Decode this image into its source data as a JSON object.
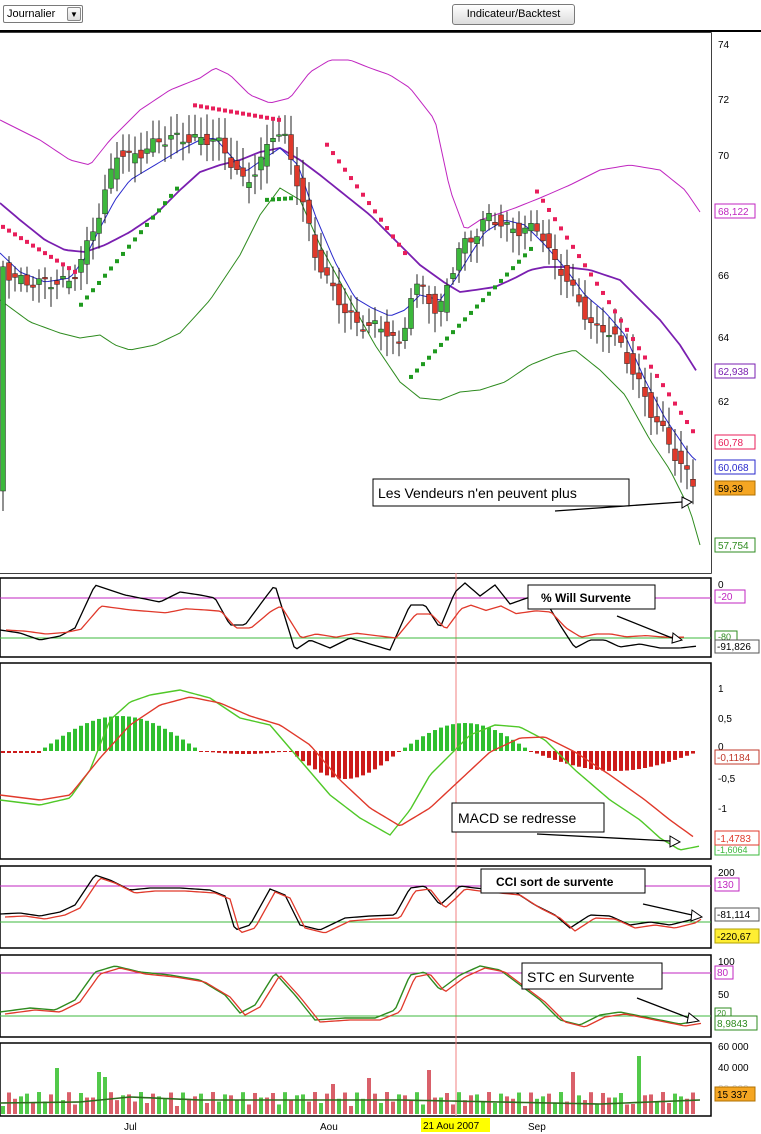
{
  "toolbar": {
    "period_value": "Journalier",
    "indicator_button": "Indicateur/Backtest"
  },
  "price_panel": {
    "axis_ticks": [
      "74",
      "72",
      "70",
      "68",
      "66",
      "64",
      "62",
      "60",
      "58"
    ],
    "badges": {
      "upper_band": "68,122",
      "ma": "62,938",
      "sar": "60,78",
      "fast_ma": "60,068",
      "last": "59,39",
      "lower_band": "57,754"
    },
    "annotation": "Les Vendeurs n'en peuvent plus"
  },
  "will_panel": {
    "axis_ticks": [
      "0"
    ],
    "badges": {
      "level": "-20",
      "low_level": "-80",
      "value": "-91,826"
    },
    "annotation": "% Will Survente"
  },
  "macd_panel": {
    "axis_ticks": [
      "1",
      "0,5",
      "0",
      "-0,5",
      "-1"
    ],
    "badges": {
      "hist": "-0,1184",
      "signal": "-1,4783",
      "macd": "-1,6064"
    },
    "annotation": "MACD se redresse"
  },
  "cci_panel": {
    "axis_ticks": [
      "200"
    ],
    "badges": {
      "level": "130",
      "value": "-81,114",
      "signal": "-220,67"
    },
    "annotation": "CCI sort de survente"
  },
  "stc_panel": {
    "axis_ticks": [
      "100",
      "50"
    ],
    "badges": {
      "high": "80",
      "low": "20",
      "value": "8,9843"
    },
    "annotation": "STC en Survente"
  },
  "volume_panel": {
    "axis_ticks": [
      "60 000",
      "40 000",
      "20 000"
    ],
    "badges": {
      "last": "15 337"
    }
  },
  "x_axis": {
    "labels": [
      "Jul",
      "Aou",
      "Sep"
    ],
    "cursor_label": "21 Aou 2007"
  },
  "colors": {
    "bull": "#3cb83c",
    "bear": "#e0392b",
    "upper_band": "#c026c0",
    "lower_band": "#2e8b1f",
    "ma": "#7a1fb0",
    "fast_ma": "#2a2acc",
    "sar_bear": "#e81e5a",
    "sar_bull": "#1f9a1f",
    "cursor": "#f08080",
    "highlight": "#ffff00"
  }
}
